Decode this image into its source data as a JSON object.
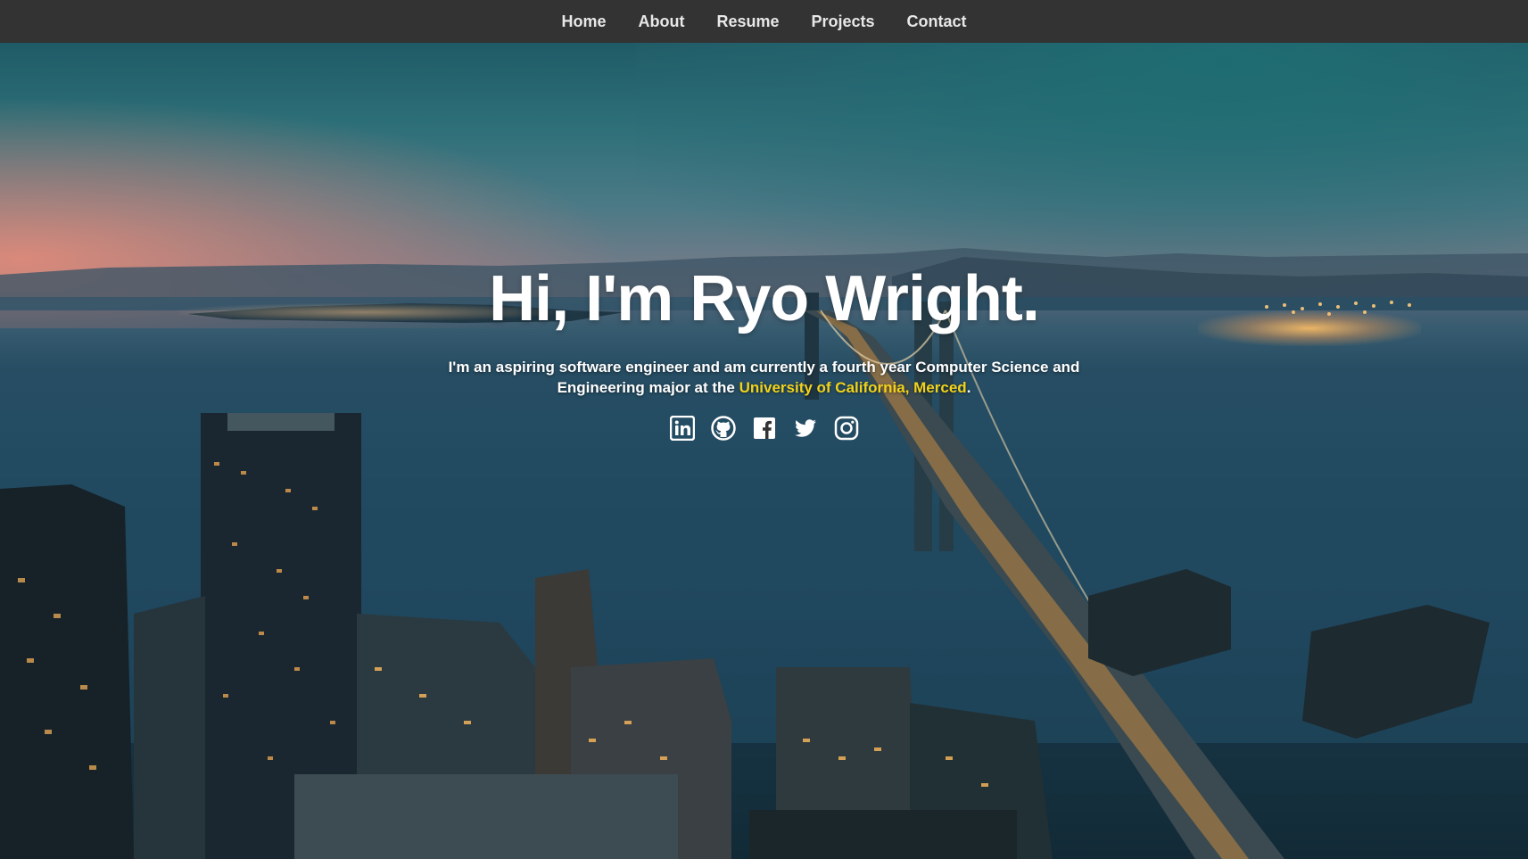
{
  "nav": {
    "items": [
      {
        "label": "Home"
      },
      {
        "label": "About"
      },
      {
        "label": "Resume"
      },
      {
        "label": "Projects"
      },
      {
        "label": "Contact"
      }
    ]
  },
  "hero": {
    "title": "Hi, I'm Ryo Wright.",
    "subtitle_line1": "I'm an aspiring software engineer and am currently a fourth year Computer Science and",
    "subtitle_line2_prefix": "Engineering major at the ",
    "university_link": "University of California, Merced",
    "subtitle_line2_suffix": ".",
    "social_icons": [
      "linkedin-icon",
      "github-icon",
      "facebook-icon",
      "twitter-icon",
      "instagram-icon"
    ]
  },
  "colors": {
    "nav_bg": "#333333",
    "link_accent": "#f2d21a",
    "text": "#ffffff"
  }
}
